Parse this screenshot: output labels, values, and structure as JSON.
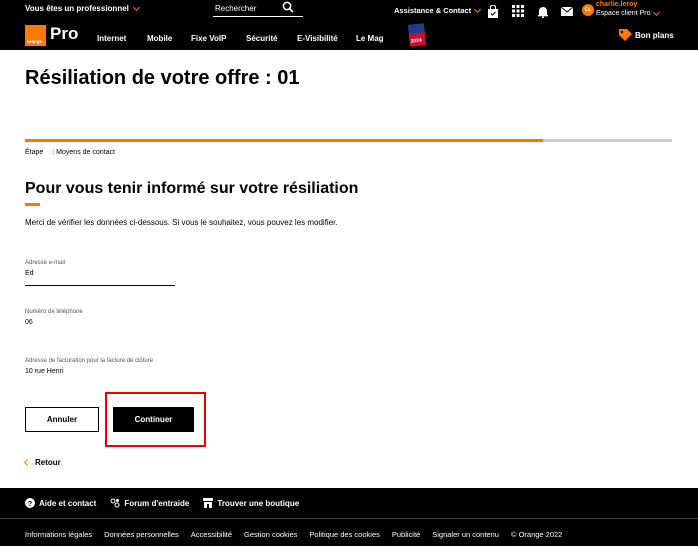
{
  "topbar": {
    "pro_select": "Vous êtes un professionnel",
    "search_placeholder": "Rechercher",
    "assistance": "Assistance & Contact",
    "account_user": "charlie.leroy",
    "account_space": "Espace client Pro",
    "avatar_initials": "CL"
  },
  "nav": {
    "logo_text": "orange",
    "brand": "Pro",
    "items": [
      "Internet",
      "Mobile",
      "Fixe VoIP",
      "Sécurité",
      "E-Visibilité",
      "Le Mag"
    ],
    "badge_year": "2024",
    "bon_plans": "Bon plans"
  },
  "page": {
    "title": "Résiliation de votre offre : 01",
    "progress": 0.8,
    "step_label": "Étape",
    "step_value": ": Moyens de contact",
    "section_title": "Pour vous tenir informé sur votre résiliation",
    "intro": "Merci de vérifier les données ci-dessous. Si vous le souhaitez, vous pouvez les modifier.",
    "fields": [
      {
        "label": "Adresse e-mail",
        "value": "Ed"
      },
      {
        "label": "Numéro de téléphone",
        "value": "06"
      },
      {
        "label": "Adresse de facturation pour la facture de clôture",
        "value": "10 rue Henri"
      }
    ],
    "cancel_label": "Annuler",
    "continue_label": "Continuer",
    "back_label": "Retour"
  },
  "footer": {
    "help": "Aide et contact",
    "forum": "Forum d'entraide",
    "store": "Trouver une boutique",
    "legal": [
      "Informations légales",
      "Données personnelles",
      "Accessibilité",
      "Gestion cookies",
      "Politique des cookies",
      "Publicité",
      "Signaler un contenu",
      "© Orange 2022"
    ]
  },
  "colors": {
    "accent": "#ff7900",
    "highlight": "#e00000"
  }
}
